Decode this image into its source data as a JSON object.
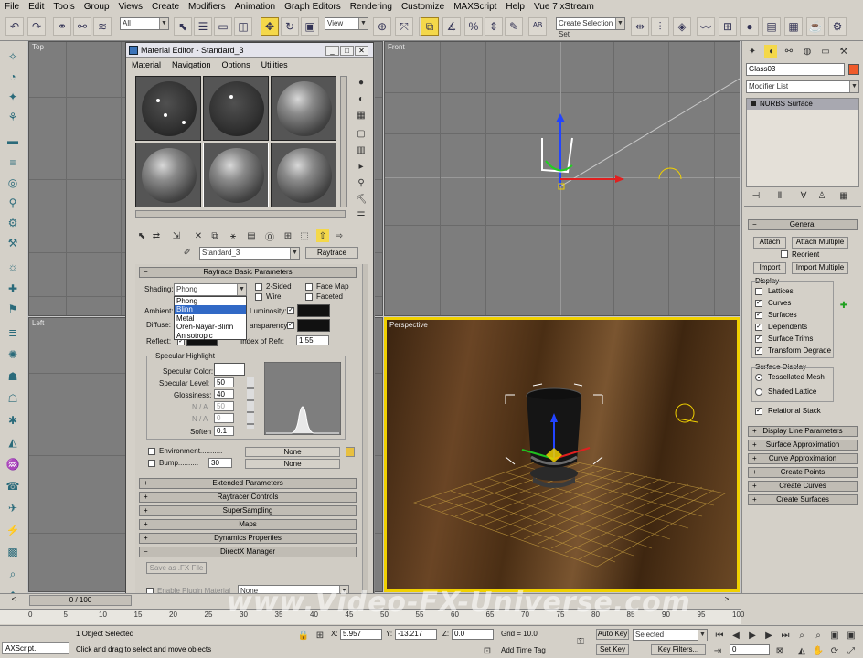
{
  "menubar": {
    "items": [
      "File",
      "Edit",
      "Tools",
      "Group",
      "Views",
      "Create",
      "Modifiers",
      "Animation",
      "Graph Editors",
      "Rendering",
      "Customize",
      "MAXScript",
      "Help",
      "Vue 7 xStream"
    ]
  },
  "toolbar": {
    "selection_filter": "All",
    "reference_coord": "View",
    "named_selection_placeholder": "Create Selection Set"
  },
  "viewports": {
    "top_label": "Top",
    "front_label": "Front",
    "left_label": "Left",
    "perspective_label": "Perspective"
  },
  "material_editor": {
    "title": "Material Editor - Standard_3",
    "menu": [
      "Material",
      "Navigation",
      "Options",
      "Utilities"
    ],
    "material_name": "Standard_3",
    "material_type": "Raytrace",
    "basic_params_title": "Raytrace Basic Parameters",
    "shading_label": "Shading:",
    "shading_value": "Phong",
    "shading_options": [
      "Phong",
      "Blinn",
      "Metal",
      "Oren-Nayar-Blinn",
      "Anisotropic"
    ],
    "shading_selected_index": 1,
    "two_sided": "2-Sided",
    "wire": "Wire",
    "face_map": "Face Map",
    "faceted": "Faceted",
    "ambient": "Ambient:",
    "diffuse": "Diffuse:",
    "reflect": "Reflect:",
    "luminosity": "Luminosity:",
    "transparency": "ansparency:",
    "index_of_refr": "Index of Refr:",
    "ior_value": "1.55",
    "specular_highlight": "Specular Highlight",
    "specular_color": "Specular Color:",
    "specular_level": "Specular Level:",
    "specular_level_value": "50",
    "glossiness": "Glossiness:",
    "glossiness_value": "40",
    "na1": "N / A",
    "na1_value": "50",
    "na2": "N / A",
    "na2_value": "0",
    "soften": "Soften",
    "soften_value": "0.1",
    "environment": "Environment...........",
    "bump": "Bump..........",
    "bump_value": "30",
    "none": "None",
    "rollouts": [
      "Extended Parameters",
      "Raytracer Controls",
      "SuperSampling",
      "Maps",
      "Dynamics Properties"
    ],
    "directx_title": "DirectX Manager",
    "save_fx": "Save as .FX File",
    "enable_plugin": "Enable Plugin Material",
    "plugin_value": "None"
  },
  "command_panel": {
    "object_name": "Glass03",
    "modifier_list": "Modifier List",
    "stack_item": "NURBS Surface",
    "general_title": "General",
    "attach": "Attach",
    "attach_multiple": "Attach Multiple",
    "reorient": "Reorient",
    "import": "Import",
    "import_multiple": "Import Multiple",
    "display_title": "Display",
    "display_items": [
      "Lattices",
      "Curves",
      "Surfaces",
      "Dependents",
      "Surface Trims",
      "Transform Degrade"
    ],
    "display_checked": [
      false,
      true,
      true,
      true,
      true,
      true
    ],
    "surface_display_title": "Surface Display",
    "tessellated_mesh": "Tessellated Mesh",
    "shaded_lattice": "Shaded Lattice",
    "relational_stack": "Relational Stack",
    "rollouts": [
      "Display Line Parameters",
      "Surface Approximation",
      "Curve Approximation",
      "Create Points",
      "Create Curves",
      "Create Surfaces"
    ]
  },
  "timeline": {
    "frame_counter": "0 / 100",
    "ticks": [
      "0",
      "5",
      "10",
      "15",
      "20",
      "25",
      "30",
      "35",
      "40",
      "45",
      "50",
      "55",
      "60",
      "65",
      "70",
      "75",
      "80",
      "85",
      "90",
      "95",
      "100"
    ]
  },
  "status": {
    "maxscript": "AXScript.",
    "selected": "1 Object Selected",
    "prompt": "Click and drag to select and move objects",
    "x_label": "X:",
    "x_value": "5.957",
    "y_label": "Y:",
    "y_value": "-13.217",
    "z_label": "Z:",
    "z_value": "0.0",
    "grid": "Grid = 10.0",
    "add_time_tag": "Add Time Tag",
    "auto_key": "Auto Key",
    "set_key": "Set Key",
    "selected_dropdown": "Selected",
    "key_filters": "Key Filters...",
    "frame_value": "0"
  },
  "watermark": "www.Video-FX-Universe.com"
}
